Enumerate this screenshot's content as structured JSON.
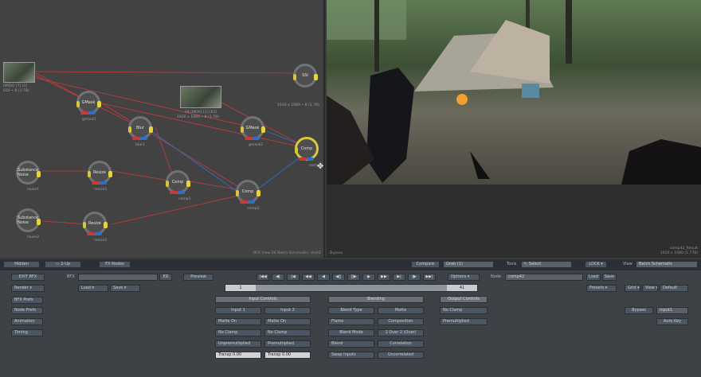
{
  "schematic": {
    "footer": "BFX View 04 Batch Schematic: shot3",
    "nodes": [
      {
        "label": "GMask",
        "sub": "gmask1"
      },
      {
        "label": "Blur",
        "sub": "blur1"
      },
      {
        "label": "GMask",
        "sub": "gmask2"
      },
      {
        "label": "Comp",
        "sub": "comp3"
      },
      {
        "label": "Substance Noise",
        "sub": "noise1"
      },
      {
        "label": "Resize",
        "sub": "resize1"
      },
      {
        "label": "Comp",
        "sub": "comp1"
      },
      {
        "label": "Comp",
        "sub": "comp2"
      },
      {
        "label": "Substance Noise",
        "sub": "noise2"
      },
      {
        "label": "Resize",
        "sub": "resize2"
      },
      {
        "label": "SSI",
        "sub": "1920 x 1080 • 8 (1.78)"
      }
    ],
    "clips": [
      {
        "name": "[MOV] [7] [1]",
        "info": "010 • 8 (1.78)"
      },
      {
        "name": "04 [MOV] [1] [61]",
        "info": "1920 x 1080 • 8 (1.78)"
      }
    ]
  },
  "viewer": {
    "label": "Bypass",
    "info_line1": "comp42_Result",
    "info_line2": "1920 x 1080 (1.778)"
  },
  "bar": {
    "hidden": "Hidden",
    "layout": "2-Up",
    "fx_nodes": "FX Nodes",
    "compare": "Compare",
    "compare_value": "Grab (1)",
    "tools": "Tools",
    "select": "Select",
    "lock": "LOCK",
    "view": "View",
    "view_value": "Batch Schematic"
  },
  "left": {
    "exit": "EXIT BFX",
    "render": "Render",
    "bfx": "BFX",
    "fx_prefs": "BFX Prefs",
    "node_prefs": "Node Prefs",
    "animation": "Animation",
    "timing": "Timing",
    "load": "Load",
    "save": "Save",
    "preview": "Preview",
    "ed": "ED"
  },
  "transport": {
    "buttons": [
      "|◀◀",
      "◀|",
      "|◀",
      "◀◀",
      "◀",
      "◀||",
      "||▶",
      "▶",
      "▶▶",
      "▶|",
      "|▶",
      "▶▶|"
    ],
    "options": "Options",
    "frame_start": "1",
    "frame_end": "41",
    "node_label": "Node",
    "node_value": "comp42",
    "load": "Load",
    "save": "Save",
    "presets": "Presets",
    "grid": "Grid",
    "view": "View",
    "default": "Default"
  },
  "input_controls": {
    "header": "Input Controls",
    "col1_header": "Input 1",
    "col2_header": "Input 2",
    "col1": [
      "Matte On",
      "No Clamp",
      "Unpremultiplied",
      "Transp 0.00"
    ],
    "col2": [
      "Matte On",
      "No Clamp",
      "Premultiplied",
      "Transp 0.00"
    ]
  },
  "blending": {
    "header": "Blending",
    "blend_type": "Blend Type",
    "matte": "Matte",
    "flame": "Flame",
    "composition": "Composition",
    "blend_mode": "Blend Mode",
    "over": "1 Over 2 (Over)",
    "blend": "Blend",
    "correlation": "Correlation",
    "swap": "Swap Inputs",
    "uncorrelated": "Uncorrelated"
  },
  "output_controls": {
    "header": "Output Controls",
    "no_clamp": "No Clamp",
    "premult": "Premultiplied"
  },
  "right": {
    "bypass": "Bypass",
    "input": "input1",
    "auto_key": "Auto Key"
  },
  "colors": {
    "link_red": "#c83a3a",
    "link_blue": "#2f6fc8",
    "socket_yellow": "#e8d43e"
  }
}
